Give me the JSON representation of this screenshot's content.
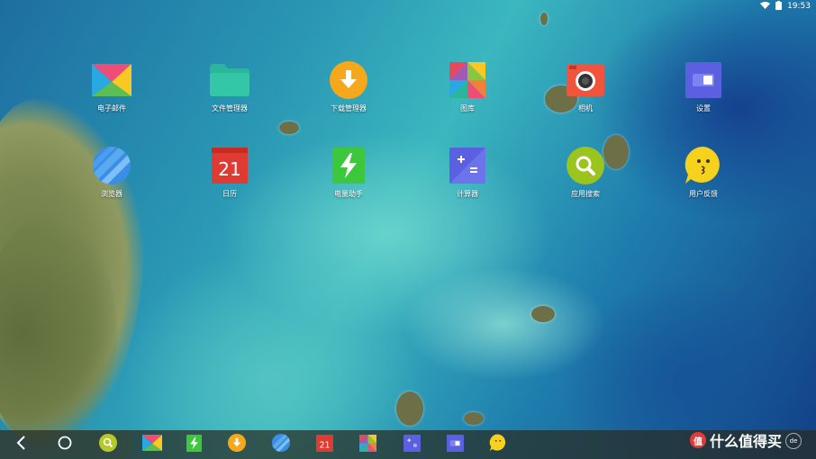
{
  "status_bar": {
    "time": "19:53",
    "wifi_icon": "wifi-icon",
    "battery_icon": "battery-icon"
  },
  "apps": [
    {
      "label": "电子邮件",
      "icon": "email-icon"
    },
    {
      "label": "文件管理器",
      "icon": "folder-icon"
    },
    {
      "label": "下载管理器",
      "icon": "download-icon"
    },
    {
      "label": "图库",
      "icon": "gallery-icon"
    },
    {
      "label": "相机",
      "icon": "camera-icon"
    },
    {
      "label": "设置",
      "icon": "settings-icon"
    },
    {
      "label": "浏览器",
      "icon": "browser-icon"
    },
    {
      "label": "日历",
      "icon": "calendar-icon",
      "date": "21"
    },
    {
      "label": "电量助手",
      "icon": "battery-assistant-icon"
    },
    {
      "label": "计算器",
      "icon": "calculator-icon"
    },
    {
      "label": "应用搜索",
      "icon": "app-search-icon"
    },
    {
      "label": "用户反馈",
      "icon": "feedback-icon"
    }
  ],
  "dock": {
    "nav": [
      "back-icon",
      "home-icon",
      "app-search-icon"
    ],
    "apps": [
      "email-icon",
      "battery-assistant-icon",
      "download-icon",
      "browser-icon",
      "calendar-icon",
      "gallery-icon",
      "calculator-icon",
      "settings-icon",
      "feedback-icon"
    ],
    "calendar_date": "21"
  },
  "watermark": {
    "text": "什么值得买",
    "badge": "值",
    "small": "de"
  },
  "colors": {
    "dock_bg": "#2d3226",
    "accent_orange": "#f5a81c",
    "accent_green": "#8cc63f"
  }
}
